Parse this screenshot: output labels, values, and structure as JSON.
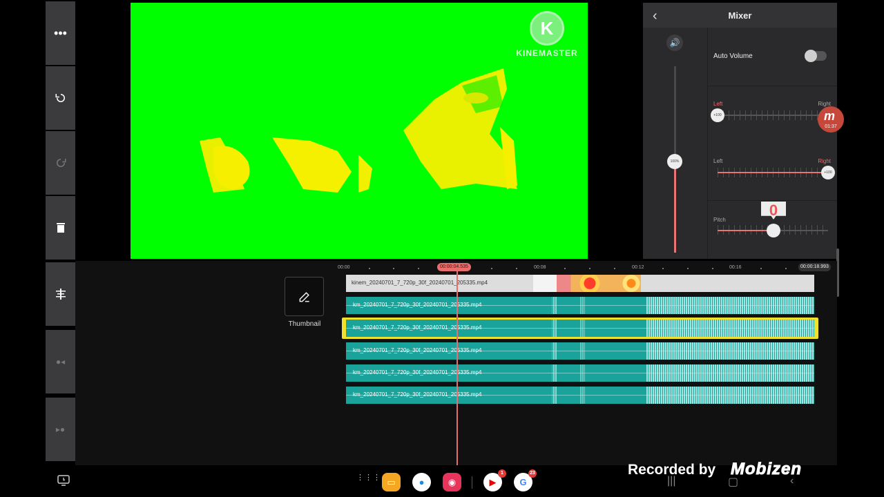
{
  "preview": {
    "watermark_letter": "K",
    "watermark_text": "KINEMASTER"
  },
  "mixer": {
    "title": "Mixer",
    "volume_value": "100%",
    "auto_volume_label": "Auto Volume",
    "auto_volume_on": false,
    "pan1": {
      "left": "Left",
      "right": "Right",
      "knob": "+100"
    },
    "pan2": {
      "left": "Left",
      "right": "Right",
      "knob": "+100"
    },
    "pitch_label": "Pitch",
    "pitch_value": "0"
  },
  "floating_badge": {
    "time": "01:37"
  },
  "timeline": {
    "ruler": [
      "00:00",
      "00:08",
      "00:12",
      "00:16"
    ],
    "current_time": "00:00:04.535",
    "end_time": "00:00:18.993",
    "thumbnail_label": "Thumbnail",
    "video_label": "kinem_20240701_7_720p_30f_20240701_205335.mp4",
    "audio_label": "km_20240701_7_720p_30f_20240701_205335.mp4"
  },
  "recorded": {
    "text": "Recorded by",
    "logo": "Mobizen"
  },
  "dock": {
    "youtube_badge": "1",
    "google_badge": "23"
  },
  "colors": {
    "accent": "#e86d6d",
    "selection": "#f0e12c",
    "audio_track": "#1aa39a",
    "chroma": "#00ff00"
  }
}
